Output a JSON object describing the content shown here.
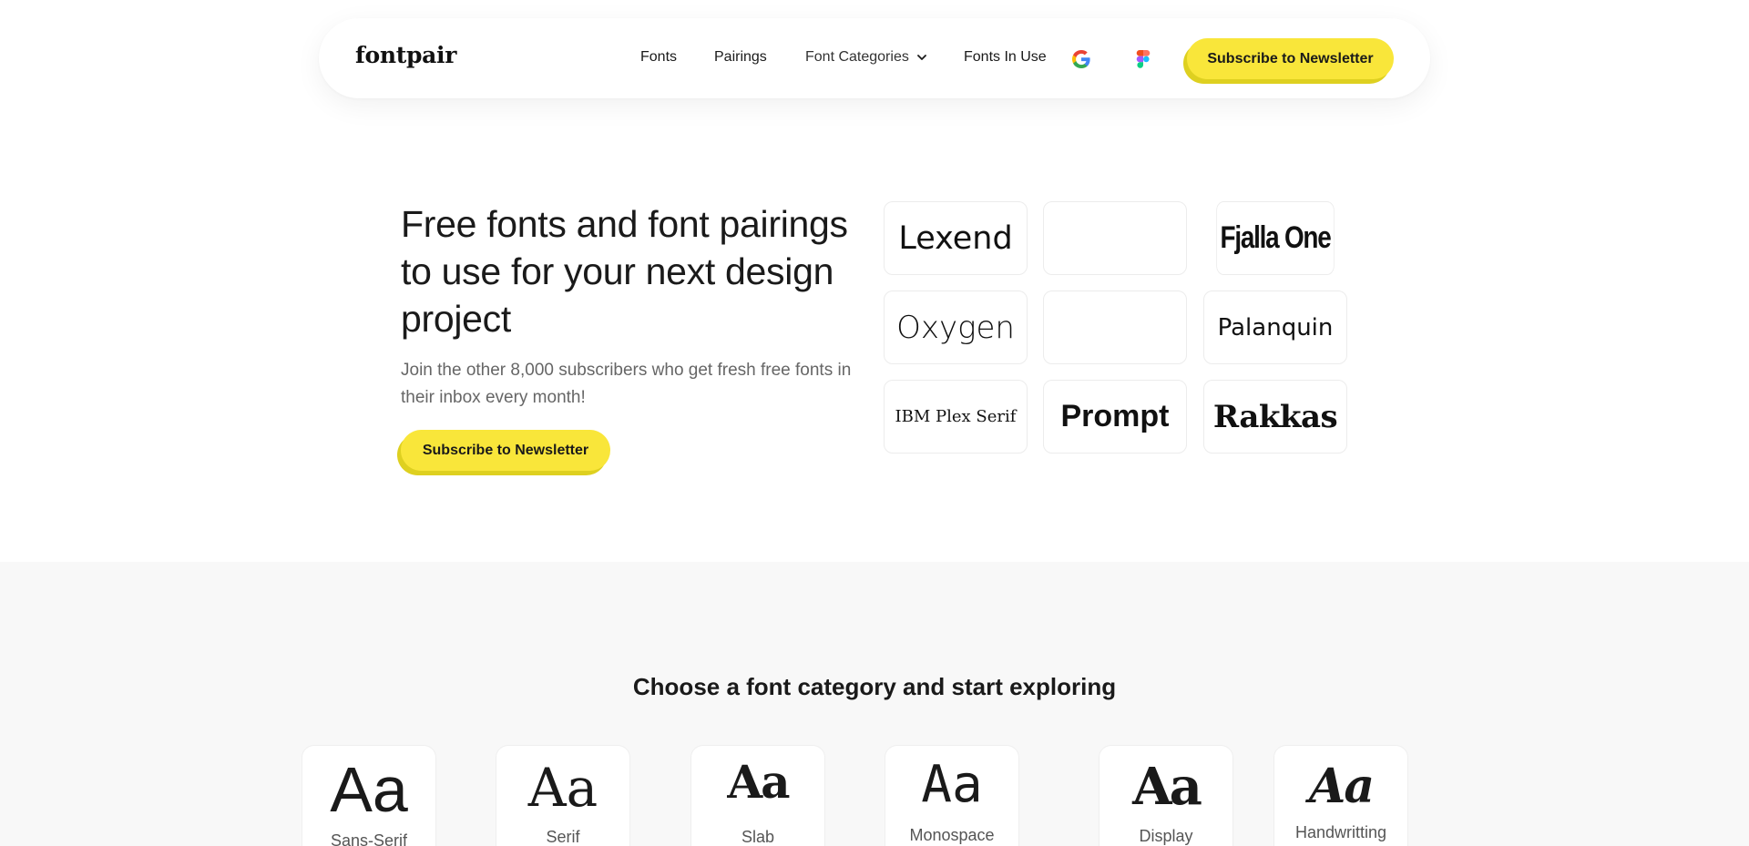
{
  "nav": {
    "logo": "fontpair",
    "links": {
      "fonts": "Fonts",
      "pairings": "Pairings",
      "categories": "Font Categories",
      "fonts_in_use": "Fonts In Use"
    },
    "icons": [
      "google-icon",
      "figma-icon",
      "chevron-down-icon"
    ],
    "cta": "Subscribe to Newsletter"
  },
  "hero": {
    "title": "Free fonts and font pairings to use for your next design project",
    "subtitle": "Join the other 8,000 subscribers who get fresh free fonts in their inbox every month!",
    "cta": "Subscribe to Newsletter",
    "tiles": [
      "Lexend",
      "",
      "Fjalla One",
      "Oxygen",
      "",
      "Palanquin",
      "IBM Plex Serif",
      "Prompt",
      "Rakkas"
    ]
  },
  "categories": {
    "heading": "Choose a font category and start exploring",
    "items": [
      {
        "sample": "Aa",
        "label": "Sans-Serif"
      },
      {
        "sample": "Aa",
        "label": "Serif"
      },
      {
        "sample": "Aa",
        "label": "Slab"
      },
      {
        "sample": "Aa",
        "label": "Monospace"
      },
      {
        "sample": "Aa",
        "label": "Display"
      },
      {
        "sample": "Aa",
        "label": "Handwritting"
      }
    ]
  },
  "colors": {
    "accent": "#f9e63a",
    "accent_shadow": "#ded020",
    "section_bg": "#f8f8f8",
    "text": "#1a1a1a",
    "muted": "#666666"
  }
}
